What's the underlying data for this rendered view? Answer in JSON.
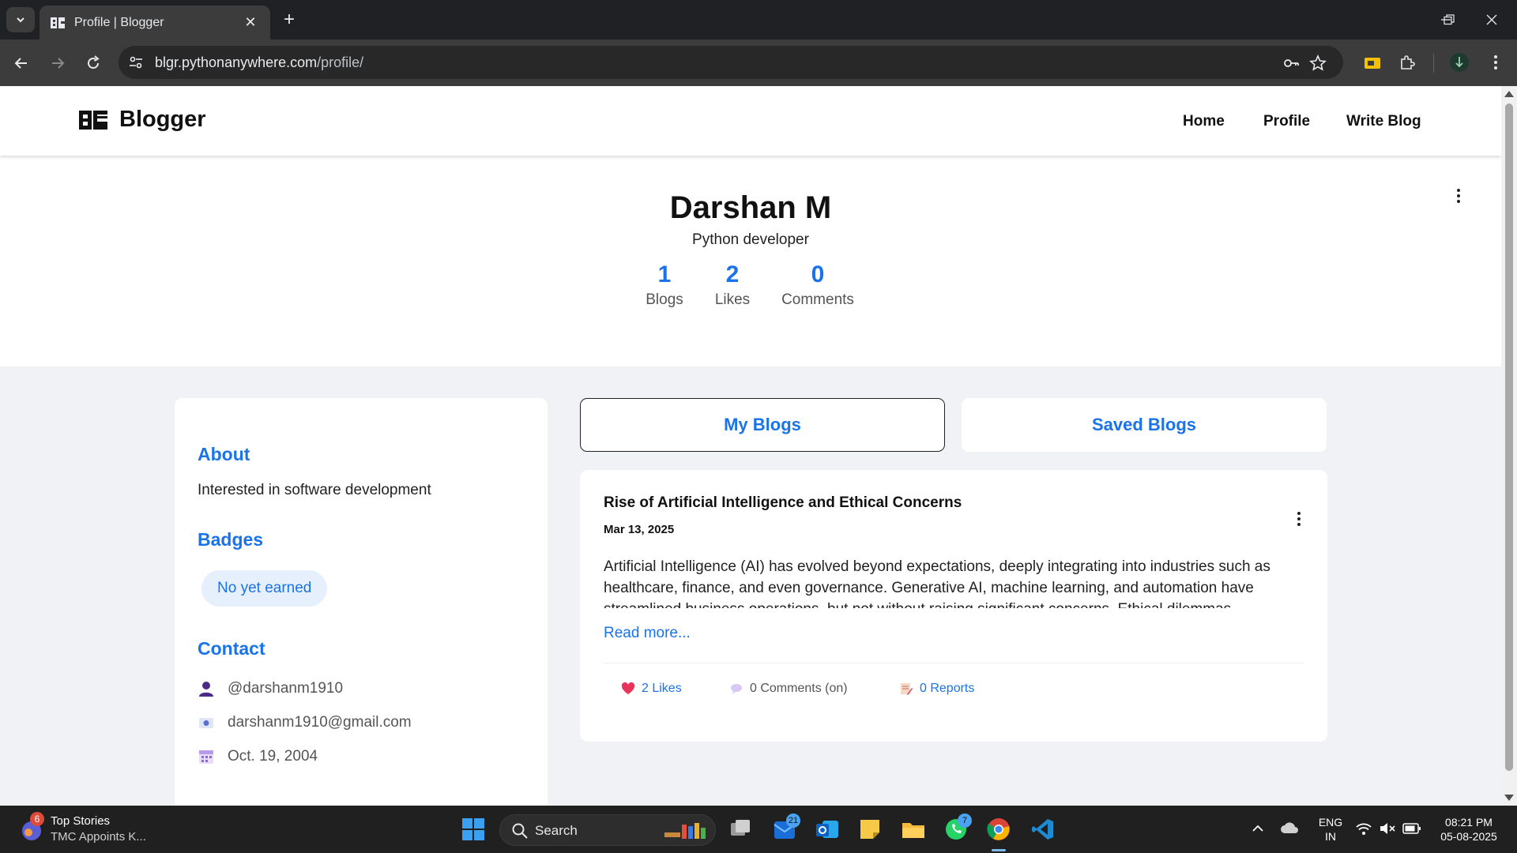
{
  "browser": {
    "tab_title": "Profile | Blogger",
    "url_host": "blgr.pythonanywhere.com",
    "url_path": "/profile/"
  },
  "navbar": {
    "brand": "Blogger",
    "links": [
      "Home",
      "Profile",
      "Write Blog"
    ]
  },
  "profile": {
    "name": "Darshan M",
    "tagline": "Python developer",
    "stats": [
      {
        "value": "1",
        "label": "Blogs"
      },
      {
        "value": "2",
        "label": "Likes"
      },
      {
        "value": "0",
        "label": "Comments"
      }
    ]
  },
  "sidebar": {
    "about_heading": "About",
    "about_text": "Interested in software development",
    "badges_heading": "Badges",
    "badge_text": "No yet earned",
    "contact_heading": "Contact",
    "contacts": [
      {
        "icon": "person-icon",
        "text": "@darshanm1910"
      },
      {
        "icon": "email-icon",
        "text": "darshanm1910@gmail.com"
      },
      {
        "icon": "calendar-icon",
        "text": "Oct. 19, 2004"
      }
    ]
  },
  "tabs": {
    "my_blogs": "My Blogs",
    "saved_blogs": "Saved Blogs",
    "active": "my_blogs"
  },
  "blog": {
    "title": "Rise of Artificial Intelligence and Ethical Concerns",
    "date": "Mar 13, 2025",
    "excerpt": "Artificial Intelligence (AI) has evolved beyond expectations, deeply integrating into industries such as healthcare, finance, and even governance. Generative AI, machine learning, and automation have streamlined business operations, but not without raising significant concerns. Ethical dilemmas",
    "read_more": "Read more...",
    "likes": "2 Likes",
    "comments": "0 Comments (on)",
    "reports": "0 Reports"
  },
  "taskbar": {
    "news_title": "Top Stories",
    "news_sub": "TMC Appoints K...",
    "news_badge": "6",
    "search_placeholder": "Search",
    "outlook_badge": "21",
    "whatsapp_badge": "7",
    "lang_top": "ENG",
    "lang_bottom": "IN",
    "time": "08:21 PM",
    "date": "05-08-2025"
  },
  "colors": {
    "accent": "#1a73e8",
    "page_bg": "#f1f2f6",
    "chrome_dark": "#202124"
  }
}
